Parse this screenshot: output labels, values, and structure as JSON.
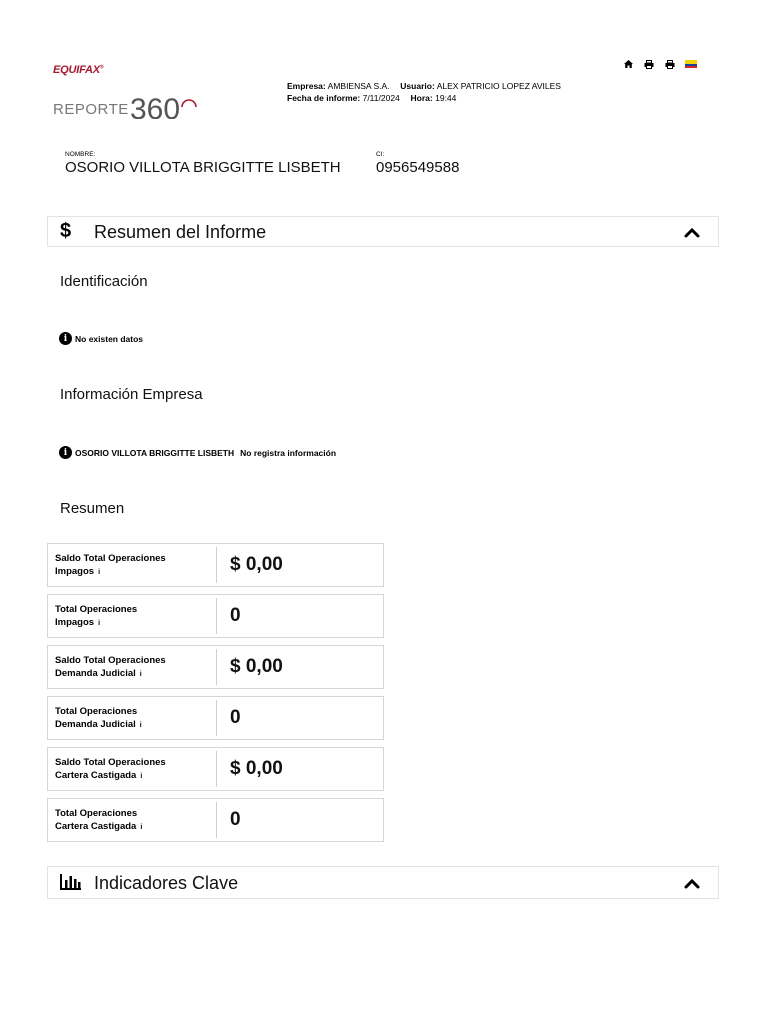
{
  "header": {
    "brand": "EQUIFAX",
    "product_word": "REPORTE",
    "product_number": "360",
    "empresa_label": "Empresa:",
    "empresa_value": "AMBIENSA S.A.",
    "usuario_label": "Usuario:",
    "usuario_value": "ALEX PATRICIO LOPEZ AVILES",
    "fecha_label": "Fecha de informe:",
    "fecha_value": "7/11/2024",
    "hora_label": "Hora:",
    "hora_value": "19:44",
    "toolbar_icons": [
      "home-icon",
      "print-icon",
      "print-icon",
      "ecuador-flag-icon"
    ]
  },
  "person": {
    "nombre_label": "NOMBRE:",
    "nombre_value": "OSORIO VILLOTA BRIGGITTE LISBETH",
    "ci_label": "CI:",
    "ci_value": "0956549588"
  },
  "resumen_section": {
    "icon": "$",
    "title": "Resumen del Informe",
    "identificacion_title": "Identificación",
    "identificacion_message": "No existen datos",
    "empresa_title": "Información Empresa",
    "empresa_name": "OSORIO VILLOTA BRIGGITTE LISBETH",
    "empresa_message": "No registra información",
    "resumen_title": "Resumen",
    "info_marker": "i",
    "cards": [
      {
        "label_line1": "Saldo Total Operaciones",
        "label_line2": "Impagos",
        "value": "$ 0,00"
      },
      {
        "label_line1": "Total Operaciones",
        "label_line2": "Impagos",
        "value": "0"
      },
      {
        "label_line1": "Saldo Total Operaciones",
        "label_line2": "Demanda Judicial",
        "value": "$ 0,00"
      },
      {
        "label_line1": "Total Operaciones",
        "label_line2": "Demanda Judicial",
        "value": "0"
      },
      {
        "label_line1": "Saldo Total Operaciones",
        "label_line2": "Cartera Castigada",
        "value": "$ 0,00"
      },
      {
        "label_line1": "Total Operaciones",
        "label_line2": "Cartera Castigada",
        "value": "0"
      }
    ]
  },
  "indicadores_section": {
    "title": "Indicadores Clave"
  },
  "colors": {
    "brand_red": "#a6192e",
    "logo_grey": "#777777",
    "border": "#e3e3e3"
  }
}
